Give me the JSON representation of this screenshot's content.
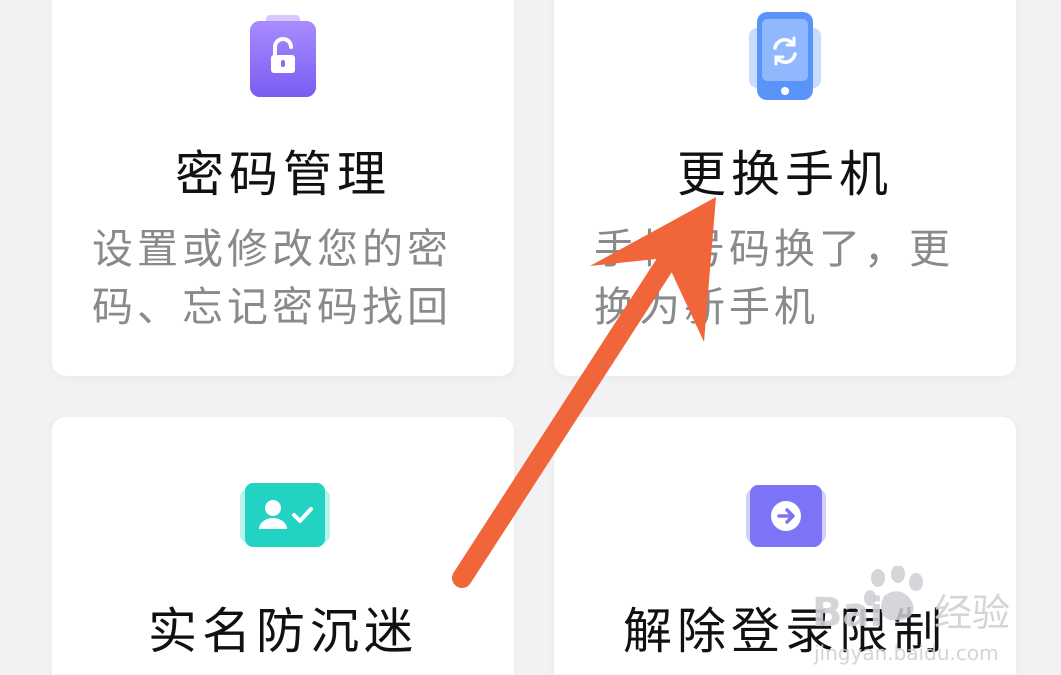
{
  "cards": [
    {
      "title": "密码管理",
      "desc": "设置或修改您的密码、忘记密码找回",
      "icon": "lock-clipboard-icon",
      "color": "#8a6cf6"
    },
    {
      "title": "更换手机",
      "desc": "手机号码换了，更换为新手机",
      "icon": "phone-refresh-icon",
      "color": "#4f8cf7"
    },
    {
      "title": "实名防沉迷",
      "icon": "user-verified-icon",
      "color": "#21d0c2"
    },
    {
      "title": "解除登录限制",
      "icon": "arrow-right-circle-icon",
      "color": "#7b74f4"
    }
  ],
  "annotation": {
    "color": "#f0663a"
  },
  "watermark": {
    "text": "Baidu经验",
    "sub": "jingyan.baidu.com"
  }
}
